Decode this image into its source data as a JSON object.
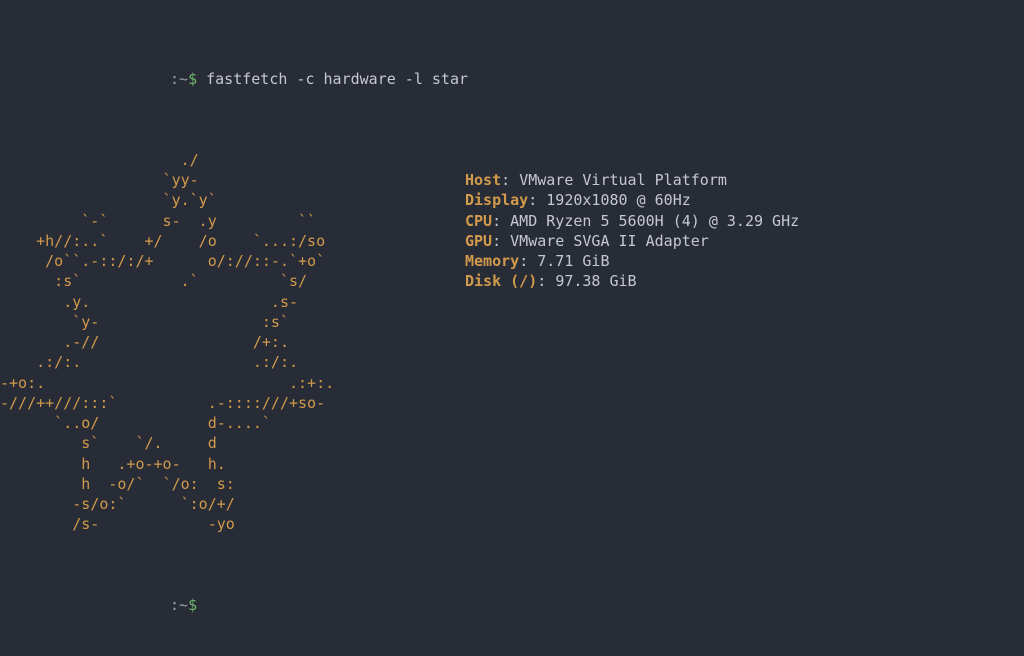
{
  "prompt": ":~",
  "dollar": "$",
  "command": "fastfetch -c hardware -l star",
  "logo": [
    "                    ./",
    "                  `yy-",
    "                  `y.`y`",
    "         `-`      s-  .y         ``",
    "    +h//:..`    +/    /o    `...:/so",
    "     /o``.-::/:/+      o/://::-.`+o`",
    "      :s`           .`         `s/",
    "       .y.                    .s-",
    "        `y-                  :s`",
    "       .-//                 /+:.",
    "    .:/:.                   .:/:.",
    "-+o:.                           .:+:.",
    "-///++///:::`          .-::::///+so-",
    "      `..o/            d-....`",
    "         s`    `/.     d",
    "         h   .+o-+o-   h.",
    "         h  -o/`  `/o:  s:",
    "        -s/o:`      `:o/+/",
    "        /s-            -yo"
  ],
  "info": [
    {
      "label": "Host",
      "sep": ": ",
      "value": "VMware Virtual Platform"
    },
    {
      "label": "Display",
      "sep": ": ",
      "value": "1920x1080 @ 60Hz"
    },
    {
      "label": "CPU",
      "sep": ": ",
      "value": "AMD Ryzen 5 5600H (4) @ 3.29 GHz"
    },
    {
      "label": "GPU",
      "sep": ": ",
      "value": "VMware SVGA II Adapter"
    },
    {
      "label": "Memory",
      "sep": ": ",
      "value": "7.71 GiB"
    },
    {
      "label": "Disk",
      "paren": " (/)",
      "sep": ": ",
      "value": "97.38 GiB"
    }
  ],
  "prompt2": ":~",
  "dollar2": "$"
}
